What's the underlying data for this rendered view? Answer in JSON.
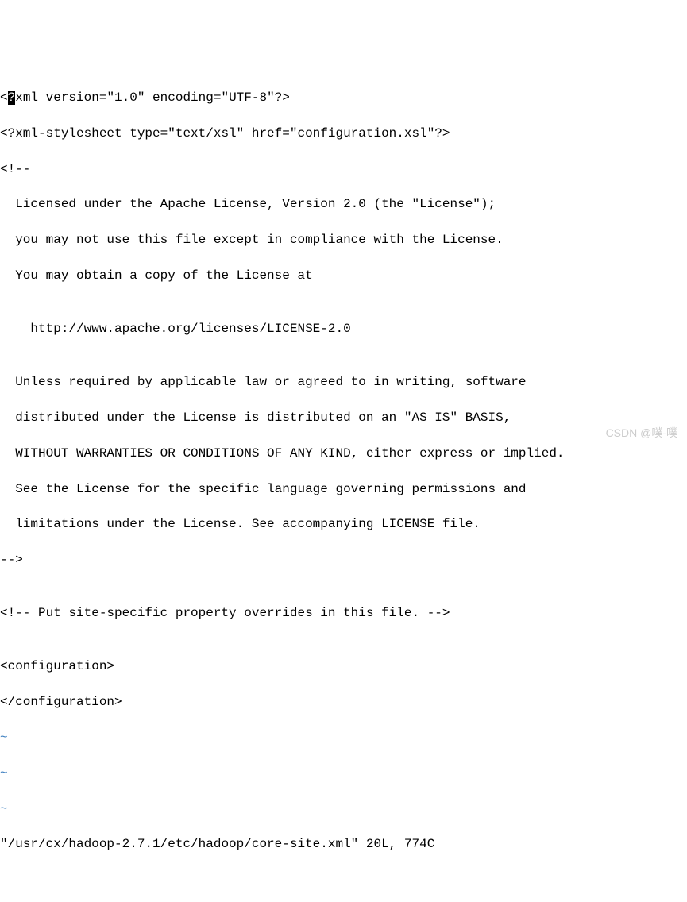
{
  "editor": {
    "lines": [
      {
        "prefix": "<",
        "highlight": "?",
        "rest": "xml version=\"1.0\" encoding=\"UTF-8\"?>"
      },
      {
        "text": "<?xml-stylesheet type=\"text/xsl\" href=\"configuration.xsl\"?>"
      },
      {
        "text": "<!--"
      },
      {
        "text": "  Licensed under the Apache License, Version 2.0 (the \"License\");"
      },
      {
        "text": "  you may not use this file except in compliance with the License."
      },
      {
        "text": "  You may obtain a copy of the License at"
      },
      {
        "text": ""
      },
      {
        "text": "    http://www.apache.org/licenses/LICENSE-2.0"
      },
      {
        "text": ""
      },
      {
        "text": "  Unless required by applicable law or agreed to in writing, software"
      },
      {
        "text": "  distributed under the License is distributed on an \"AS IS\" BASIS,"
      },
      {
        "text": "  WITHOUT WARRANTIES OR CONDITIONS OF ANY KIND, either express or implied."
      },
      {
        "text": "  See the License for the specific language governing permissions and"
      },
      {
        "text": "  limitations under the License. See accompanying LICENSE file."
      },
      {
        "text": "-->"
      },
      {
        "text": ""
      },
      {
        "text": "<!-- Put site-specific property overrides in this file. -->"
      },
      {
        "text": ""
      },
      {
        "text": "<configuration>"
      },
      {
        "text": "</configuration>"
      }
    ],
    "tilde": "~",
    "status": "\"/usr/cx/hadoop-2.7.1/etc/hadoop/core-site.xml\" 20L, 774C"
  },
  "watermark": "CSDN @噗-噗"
}
